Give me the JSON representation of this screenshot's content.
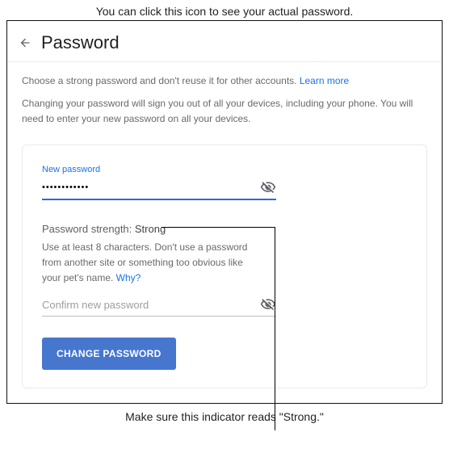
{
  "annotations": {
    "top": "You can click this icon to see your actual password.",
    "bottom": "Make sure this indicator reads \"Strong.\""
  },
  "header": {
    "title": "Password"
  },
  "description": {
    "line1_prefix": "Choose a strong password and don't reuse it for other accounts. ",
    "learn_more": "Learn more",
    "line2": "Changing your password will sign you out of all your devices, including your phone. You will need to enter your new password on all your devices."
  },
  "form": {
    "new_password_label": "New password",
    "new_password_value": "••••••••••••",
    "strength_label": "Password strength: ",
    "strength_value": "Strong",
    "hint_text": "Use at least 8 characters. Don't use a password from another site or something too obvious like your pet's name. ",
    "hint_link": "Why?",
    "confirm_placeholder": "Confirm new password",
    "submit_label": "CHANGE PASSWORD"
  }
}
